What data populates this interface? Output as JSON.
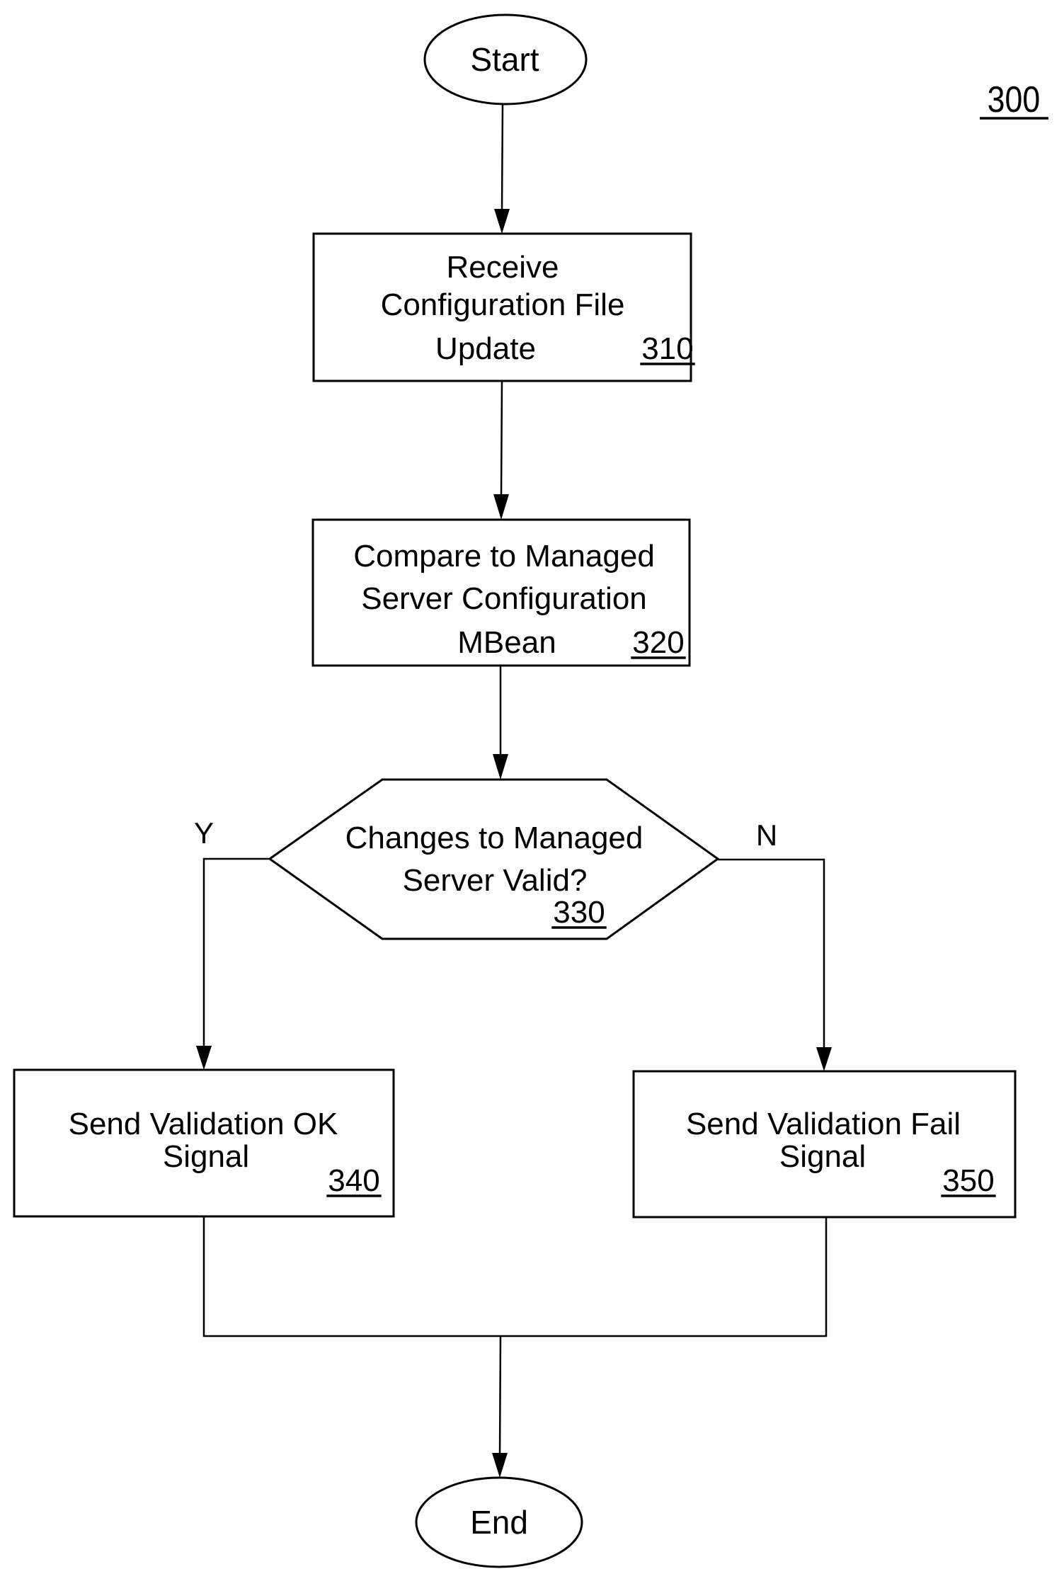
{
  "figure": {
    "number": "300"
  },
  "nodes": {
    "start": {
      "type": "terminal",
      "label": "Start"
    },
    "n310": {
      "type": "process",
      "lines": [
        "Receive",
        "Configuration File",
        "Update"
      ],
      "ref": "310"
    },
    "n320": {
      "type": "process",
      "lines": [
        "Compare to Managed",
        "Server Configuration",
        "MBean"
      ],
      "ref": "320"
    },
    "n330": {
      "type": "decision",
      "lines": [
        "Changes to Managed",
        "Server Valid?"
      ],
      "ref": "330"
    },
    "n340": {
      "type": "process",
      "lines": [
        "Send Validation OK",
        "Signal"
      ],
      "ref": "340"
    },
    "n350": {
      "type": "process",
      "lines": [
        "Send Validation Fail",
        "Signal"
      ],
      "ref": "350"
    },
    "end": {
      "type": "terminal",
      "label": "End"
    }
  },
  "branches": {
    "yes": "Y",
    "no": "N"
  },
  "edges": [
    {
      "from": "start",
      "to": "n310"
    },
    {
      "from": "n310",
      "to": "n320"
    },
    {
      "from": "n320",
      "to": "n330"
    },
    {
      "from": "n330",
      "to": "n340",
      "label": "Y"
    },
    {
      "from": "n330",
      "to": "n350",
      "label": "N"
    },
    {
      "from": "n340",
      "to": "end"
    },
    {
      "from": "n350",
      "to": "end"
    }
  ],
  "colors": {
    "stroke": "#000000",
    "background": "#ffffff"
  }
}
